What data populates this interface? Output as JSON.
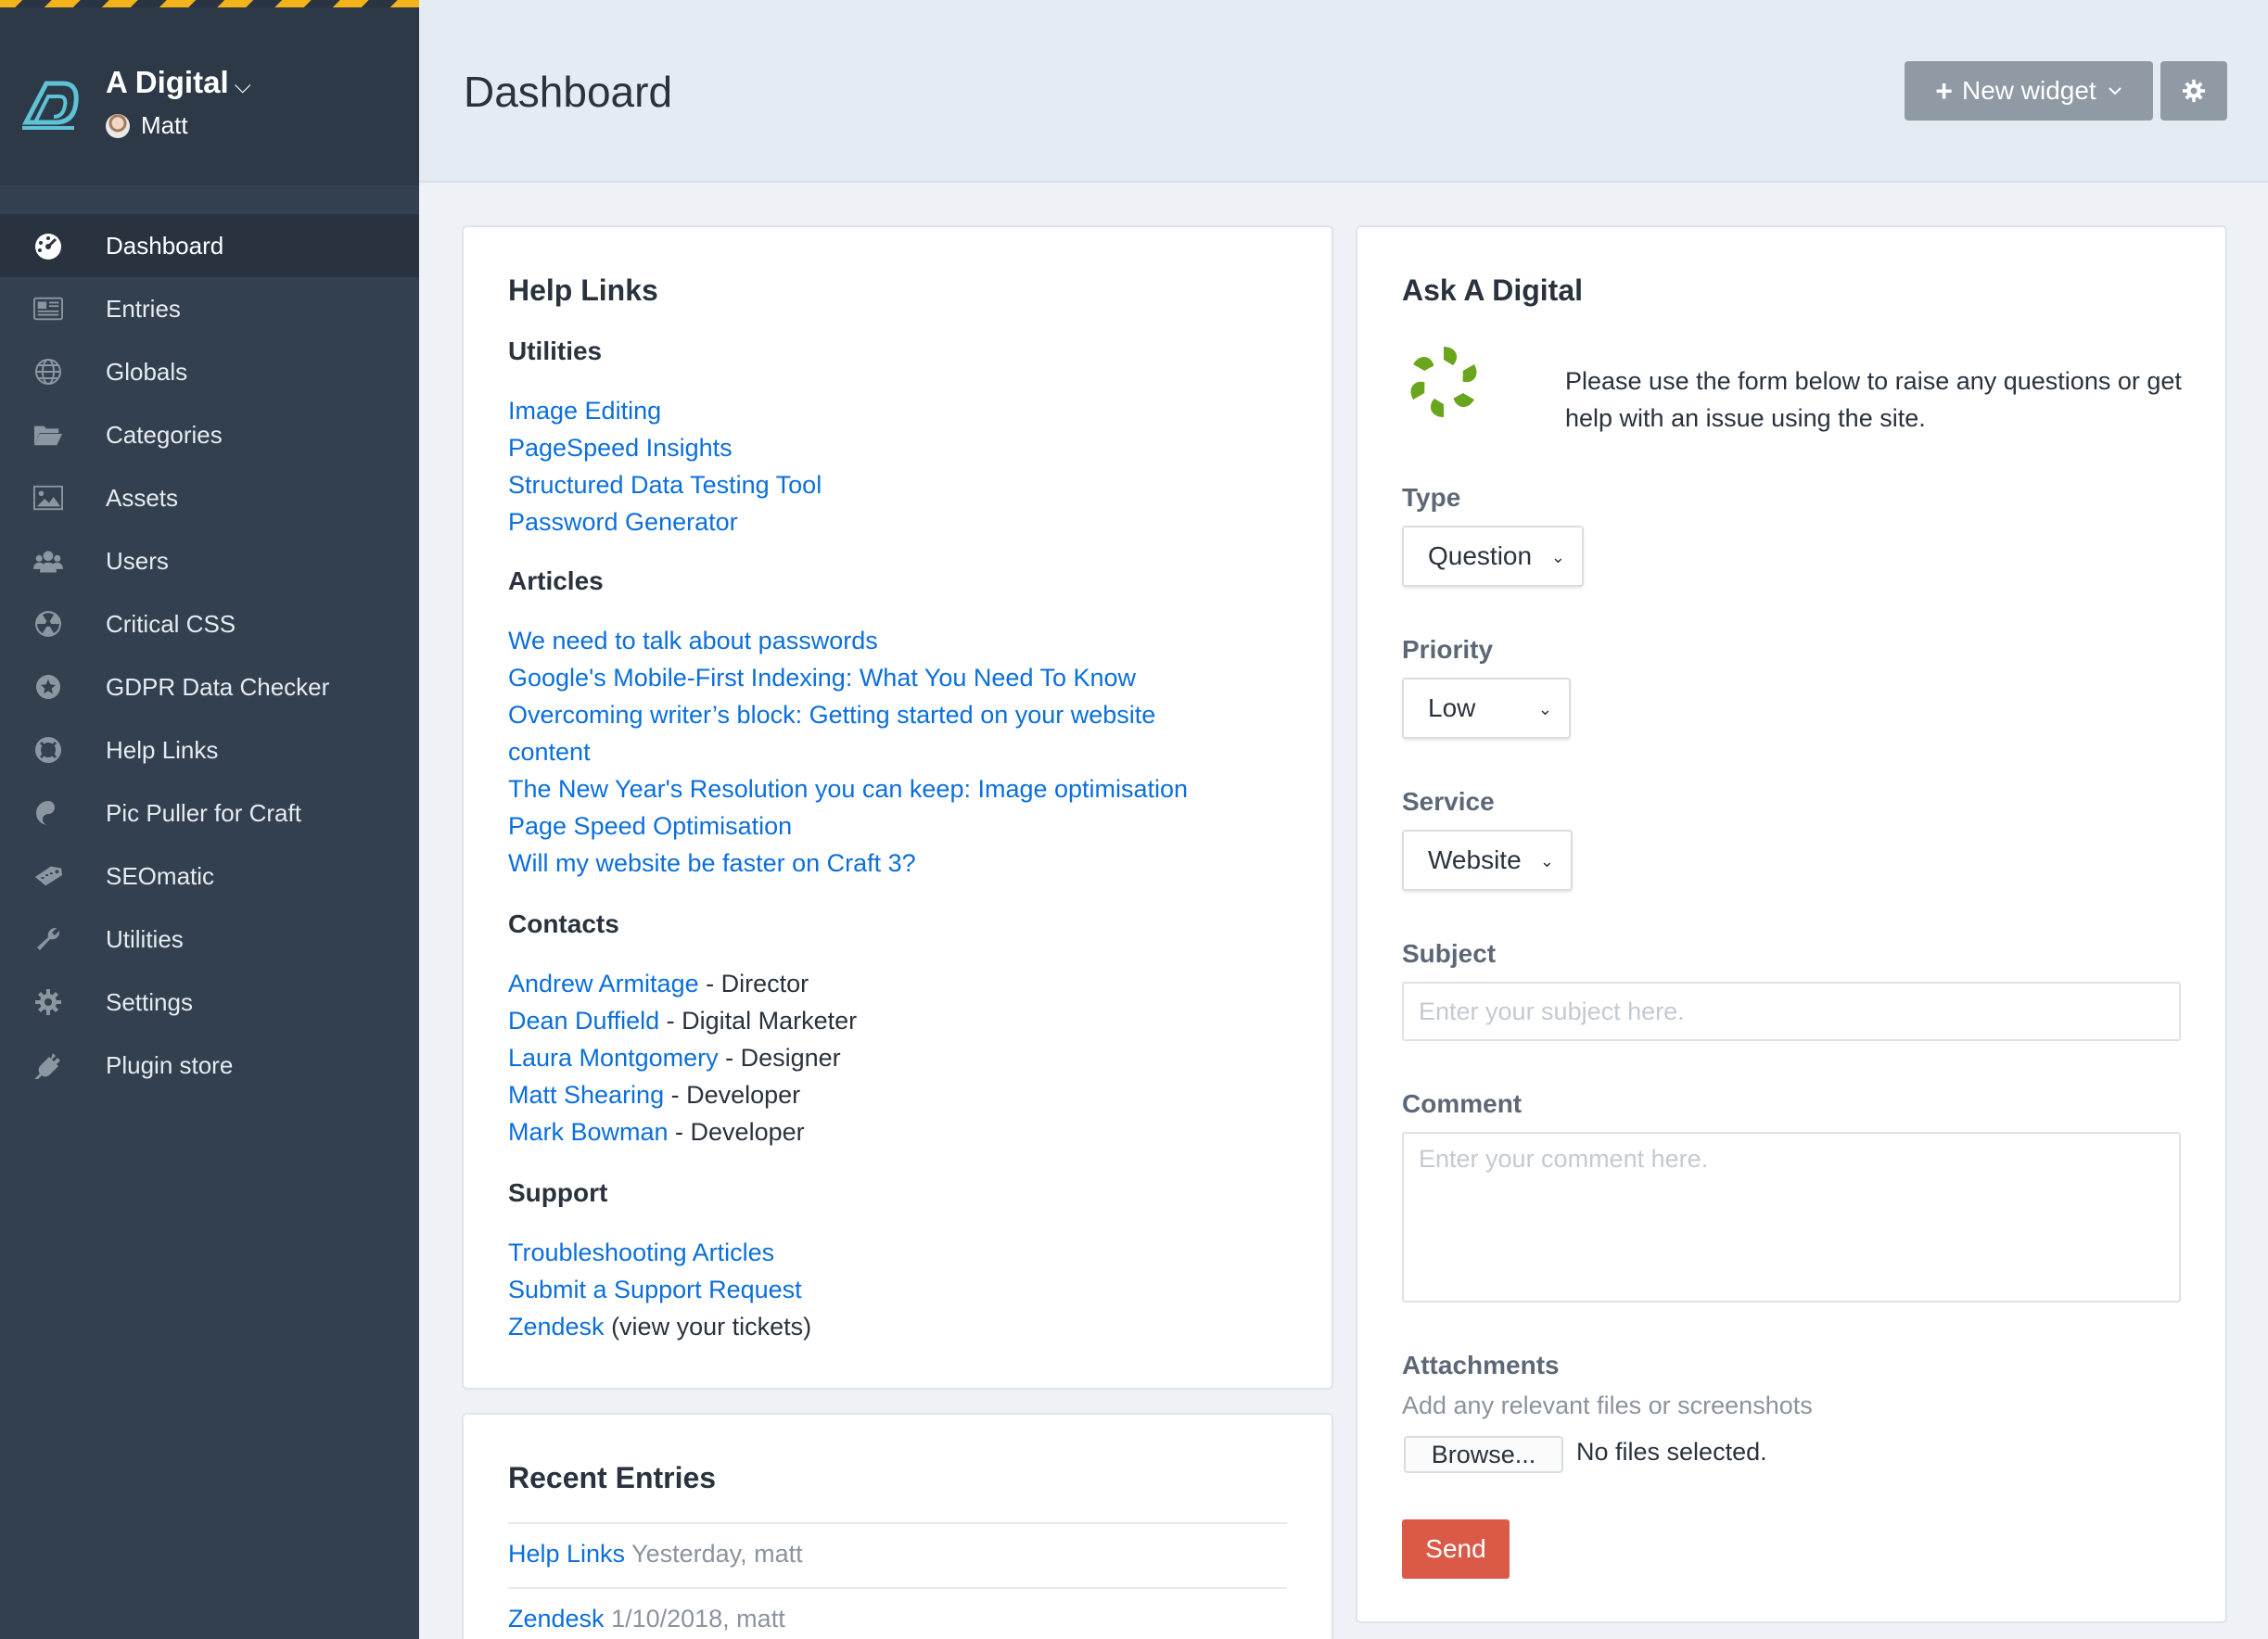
{
  "sidebar": {
    "site_name": "A Digital",
    "site_caret": "⌵",
    "user_name": "Matt",
    "items": [
      {
        "label": "Dashboard",
        "icon": "dashboard-gauge-icon"
      },
      {
        "label": "Entries",
        "icon": "newspaper-icon"
      },
      {
        "label": "Globals",
        "icon": "globe-icon"
      },
      {
        "label": "Categories",
        "icon": "folder-open-icon"
      },
      {
        "label": "Assets",
        "icon": "image-icon"
      },
      {
        "label": "Users",
        "icon": "users-icon"
      },
      {
        "label": "Critical CSS",
        "icon": "radiation-icon"
      },
      {
        "label": "GDPR Data Checker",
        "icon": "badge-star-icon"
      },
      {
        "label": "Help Links",
        "icon": "life-ring-icon"
      },
      {
        "label": "Pic Puller for Craft",
        "icon": "pic-puller-icon"
      },
      {
        "label": "SEOmatic",
        "icon": "seo-tag-icon"
      },
      {
        "label": "Utilities",
        "icon": "wrench-icon"
      },
      {
        "label": "Settings",
        "icon": "gear-icon"
      },
      {
        "label": "Plugin store",
        "icon": "plug-icon"
      }
    ],
    "active_index": 0
  },
  "header": {
    "title": "Dashboard",
    "new_widget_label": "New widget",
    "accent_button_color": "#909aa5"
  },
  "help_links": {
    "title": "Help Links",
    "utilities_heading": "Utilities",
    "utilities": [
      "Image Editing",
      "PageSpeed Insights",
      "Structured Data Testing Tool",
      "Password Generator"
    ],
    "articles_heading": "Articles",
    "articles": [
      "We need to talk about passwords",
      "Google's Mobile-First Indexing: What You Need To Know",
      "Overcoming writer’s block: Getting started on your website",
      "content",
      "The New Year's Resolution you can keep: Image optimisation",
      "Page Speed Optimisation",
      "Will my website be faster on Craft 3?"
    ],
    "contacts_heading": "Contacts",
    "contacts": [
      {
        "name": "Andrew Armitage",
        "role": " - Director"
      },
      {
        "name": "Dean Duffield",
        "role": " - Digital Marketer"
      },
      {
        "name": "Laura Montgomery",
        "role": " - Designer"
      },
      {
        "name": "Matt Shearing",
        "role": " - Developer"
      },
      {
        "name": "Mark Bowman",
        "role": " - Developer"
      }
    ],
    "support_heading": "Support",
    "support": [
      {
        "link": "Troubleshooting Articles",
        "suffix": ""
      },
      {
        "link": "Submit a Support Request",
        "suffix": ""
      },
      {
        "link": "Zendesk",
        "suffix": " (view your tickets)"
      }
    ]
  },
  "recent_entries": {
    "title": "Recent Entries",
    "entries": [
      {
        "title": "Help Links",
        "meta": " Yesterday, matt"
      },
      {
        "title": "Zendesk",
        "meta": " 1/10/2018, matt"
      }
    ]
  },
  "ask": {
    "title": "Ask A Digital",
    "intro": "Please use the form below to raise any questions or get help with an issue using the site.",
    "type_label": "Type",
    "type_value": "Question",
    "priority_label": "Priority",
    "priority_value": "Low",
    "service_label": "Service",
    "service_value": "Website",
    "subject_label": "Subject",
    "subject_placeholder": "Enter your subject here.",
    "comment_label": "Comment",
    "comment_placeholder": "Enter your comment here.",
    "attachments_label": "Attachments",
    "attachments_hint": "Add any relevant files or screenshots",
    "browse_label": "Browse...",
    "no_files": "No files selected.",
    "send_label": "Send",
    "send_color": "#da5a47",
    "logo_color": "#6aa51e"
  }
}
